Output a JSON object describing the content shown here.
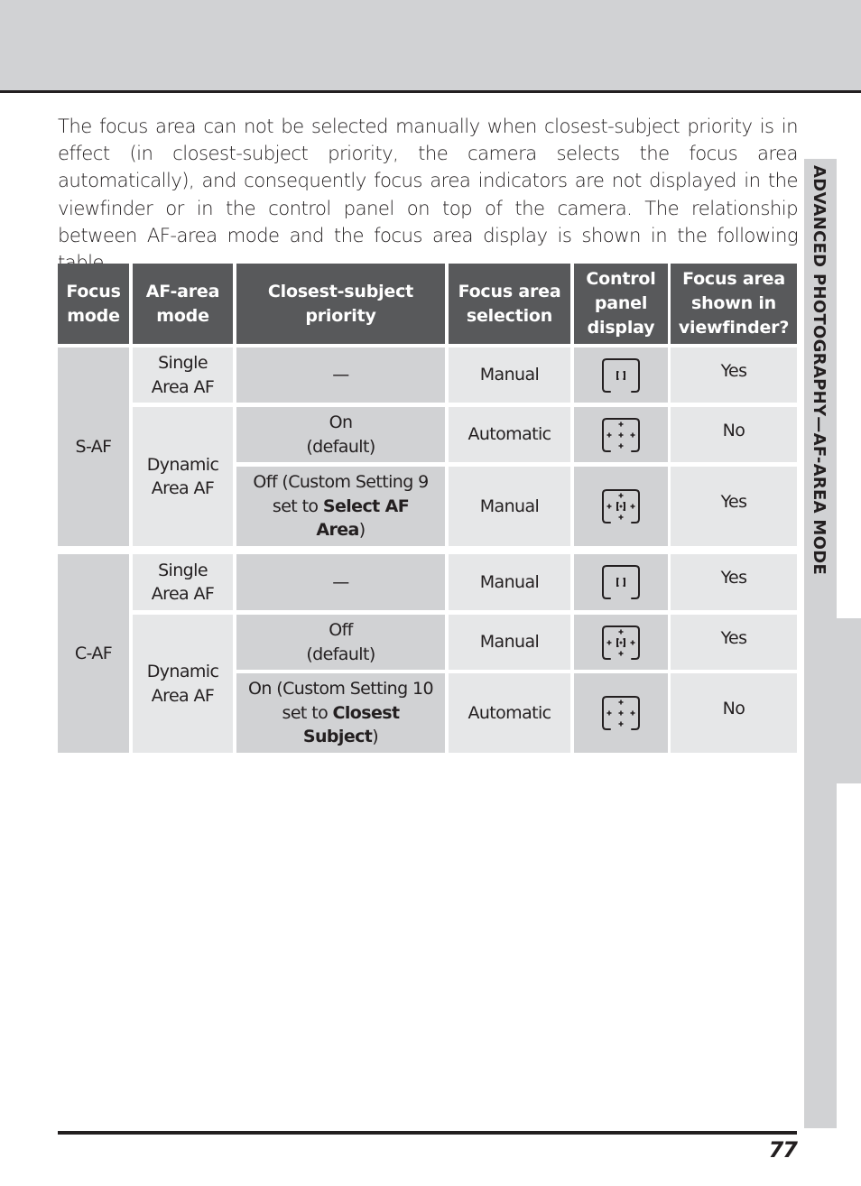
{
  "page": {
    "intro_text": "The focus area can not be selected manually when closest-subject priority is in effect (in closest-subject priority, the camera selects the focus area automatically), and consequently focus area indicators are not displayed in the viewfinder or in the control panel on top of the camera.  The relationship between AF-area mode and the focus area display is shown in the following table.",
    "side_label": "ADVANCED PHOTOGRAPHY—AF-AREA MODE",
    "page_number": "77"
  },
  "table": {
    "headers": [
      "Focus mode",
      "AF-area mode",
      "Closest-subject priority",
      "Focus area selection",
      "Control panel display",
      "Focus area shown in viewfinder?"
    ],
    "focus_modes": [
      "S-AF",
      "C-AF"
    ],
    "af_area_modes": [
      "Single Area AF",
      "Dynamic Area AF",
      "Single Area AF",
      "Dynamic Area AF"
    ],
    "rows": [
      {
        "priority": "—",
        "priority_rich": null,
        "selection": "Manual",
        "display_icon": "single-area-bracket-icon",
        "viewfinder": "Yes"
      },
      {
        "priority": "On\n(default)",
        "priority_rich": null,
        "selection": "Automatic",
        "display_icon": "dynamic-area-no-bracket-icon",
        "viewfinder": "No"
      },
      {
        "priority": "Off (Custom Setting 9 set to Select AF Area)",
        "priority_rich": {
          "pre": "Off (Custom Setting 9 set to ",
          "bold": "Select AF Area",
          "post": ")"
        },
        "selection": "Manual",
        "display_icon": "dynamic-area-center-bracket-icon",
        "viewfinder": "Yes"
      },
      {
        "priority": "—",
        "priority_rich": null,
        "selection": "Manual",
        "display_icon": "single-area-bracket-icon",
        "viewfinder": "Yes"
      },
      {
        "priority": "Off\n(default)",
        "priority_rich": null,
        "selection": "Manual",
        "display_icon": "dynamic-area-center-bracket-icon",
        "viewfinder": "Yes"
      },
      {
        "priority": "On (Custom Setting 10 set to Closest Subject)",
        "priority_rich": {
          "pre": "On (Custom Setting 10 set to ",
          "bold": "Closest Subject",
          "post": ")"
        },
        "selection": "Automatic",
        "display_icon": "dynamic-area-no-bracket-icon",
        "viewfinder": "No"
      }
    ]
  }
}
